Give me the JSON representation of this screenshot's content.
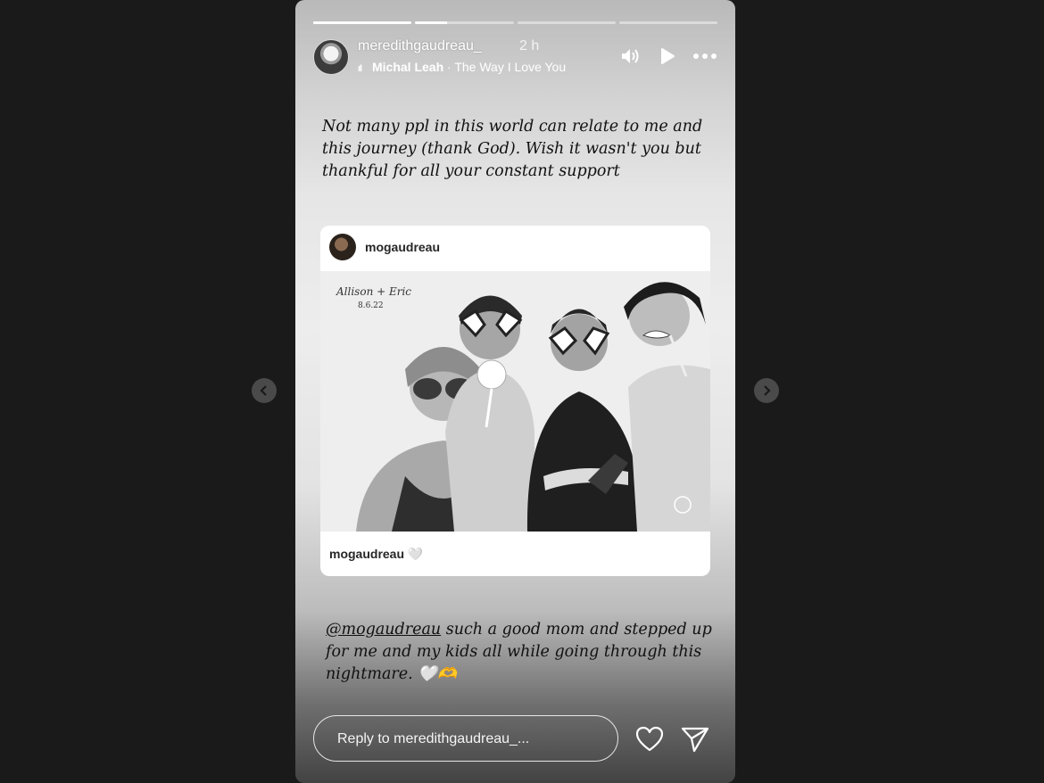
{
  "header": {
    "username": "meredithgaudreau_",
    "time": "2 h",
    "music_artist": "Michal Leah",
    "music_separator": "·",
    "music_title": "The Way I Love You"
  },
  "progress": [
    1,
    0.32,
    0,
    0
  ],
  "story": {
    "caption_top": "Not many ppl in this world can relate to me and this journey (thank God). Wish it wasn't you but thankful for all your constant support",
    "shared_post": {
      "username": "mogaudreau",
      "photo_tag": "Allison + Eric",
      "photo_date": "8.6.22",
      "caption_user": "mogaudreau",
      "caption_emoji": "🤍"
    },
    "caption_bottom_mention": "@mogaudreau",
    "caption_bottom_text": " such a good mom and stepped up for me and my kids all while going through this nightmare. 🤍🫶"
  },
  "reply": {
    "placeholder": "Reply to meredithgaudreau_..."
  },
  "icons": {
    "volume": "volume-icon",
    "play": "play-icon",
    "more": "more-icon",
    "like": "heart-icon",
    "send": "send-icon",
    "prev": "chevron-left-icon",
    "next": "chevron-right-icon"
  }
}
